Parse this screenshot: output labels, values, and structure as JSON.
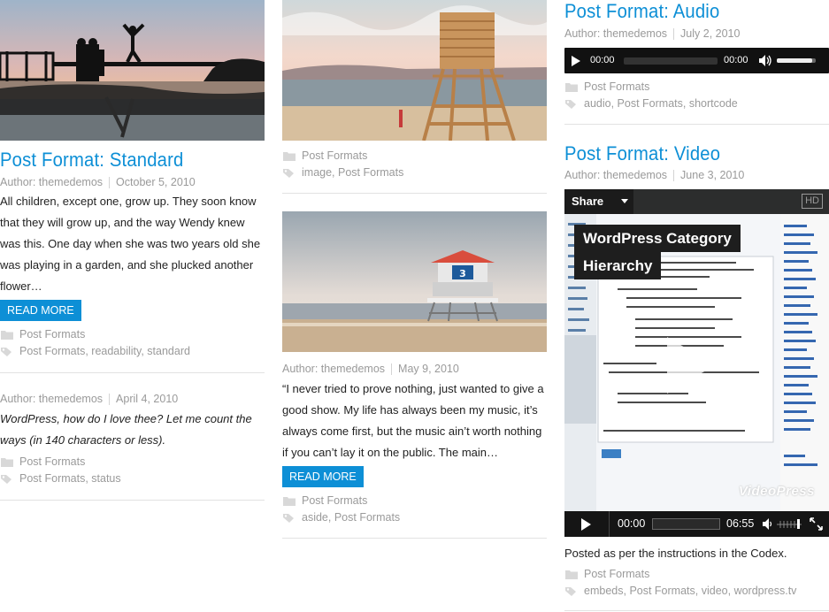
{
  "col1": {
    "post1": {
      "title": "Post Format: Standard",
      "author": "Author: themedemos",
      "date": "October 5, 2010",
      "excerpt_lines": [
        "All children, except one, grow up. They soon know",
        "that they will grow up, and the way Wendy knew",
        "was this. One day when she was two years old she",
        "was playing in a garden, and she plucked another",
        "flower…"
      ],
      "read_more": "READ MORE",
      "category": "Post Formats",
      "tags": [
        "Post Formats",
        "readability",
        "standard"
      ]
    },
    "post2": {
      "author": "Author: themedemos",
      "date": "April 4, 2010",
      "excerpt_lines": [
        "WordPress, how do I love thee? Let me count the",
        "ways (in 140 characters or less)."
      ],
      "category": "Post Formats",
      "tags": [
        "Post Formats",
        "status"
      ]
    }
  },
  "col2": {
    "post1": {
      "category": "Post Formats",
      "tags": [
        "image",
        "Post Formats"
      ]
    },
    "post2": {
      "author": "Author: themedemos",
      "date": "May 9, 2010",
      "excerpt_lines": [
        "“I never tried to prove nothing, just wanted to give a",
        "good show. My life has always been my music, it’s",
        "always come first, but the music ain’t worth nothing",
        "if you can’t lay it on the public. The main…"
      ],
      "read_more": "READ MORE",
      "category": "Post Formats",
      "tags": [
        "aside",
        "Post Formats"
      ]
    }
  },
  "col3": {
    "audio_post": {
      "title": "Post Format: Audio",
      "author": "Author: themedemos",
      "date": "July 2, 2010",
      "player": {
        "current": "00:00",
        "duration": "00:00"
      },
      "category": "Post Formats",
      "tags": [
        "audio",
        "Post Formats",
        "shortcode"
      ]
    },
    "video_post": {
      "title": "Post Format: Video",
      "author": "Author: themedemos",
      "date": "June 3, 2010",
      "player": {
        "share_label": "Share",
        "hd_label": "HD",
        "video_title_line1": "WordPress Category",
        "video_title_line2": "Hierarchy",
        "brand": "VideoPress",
        "current": "00:00",
        "duration": "06:55"
      },
      "caption": "Posted as per the instructions in the Codex.",
      "category": "Post Formats",
      "tags": [
        "embeds",
        "Post Formats",
        "video",
        "wordpress.tv"
      ]
    }
  },
  "colors": {
    "accent": "#0d8fd6",
    "meta": "#9a9a9a",
    "text": "#222222"
  }
}
